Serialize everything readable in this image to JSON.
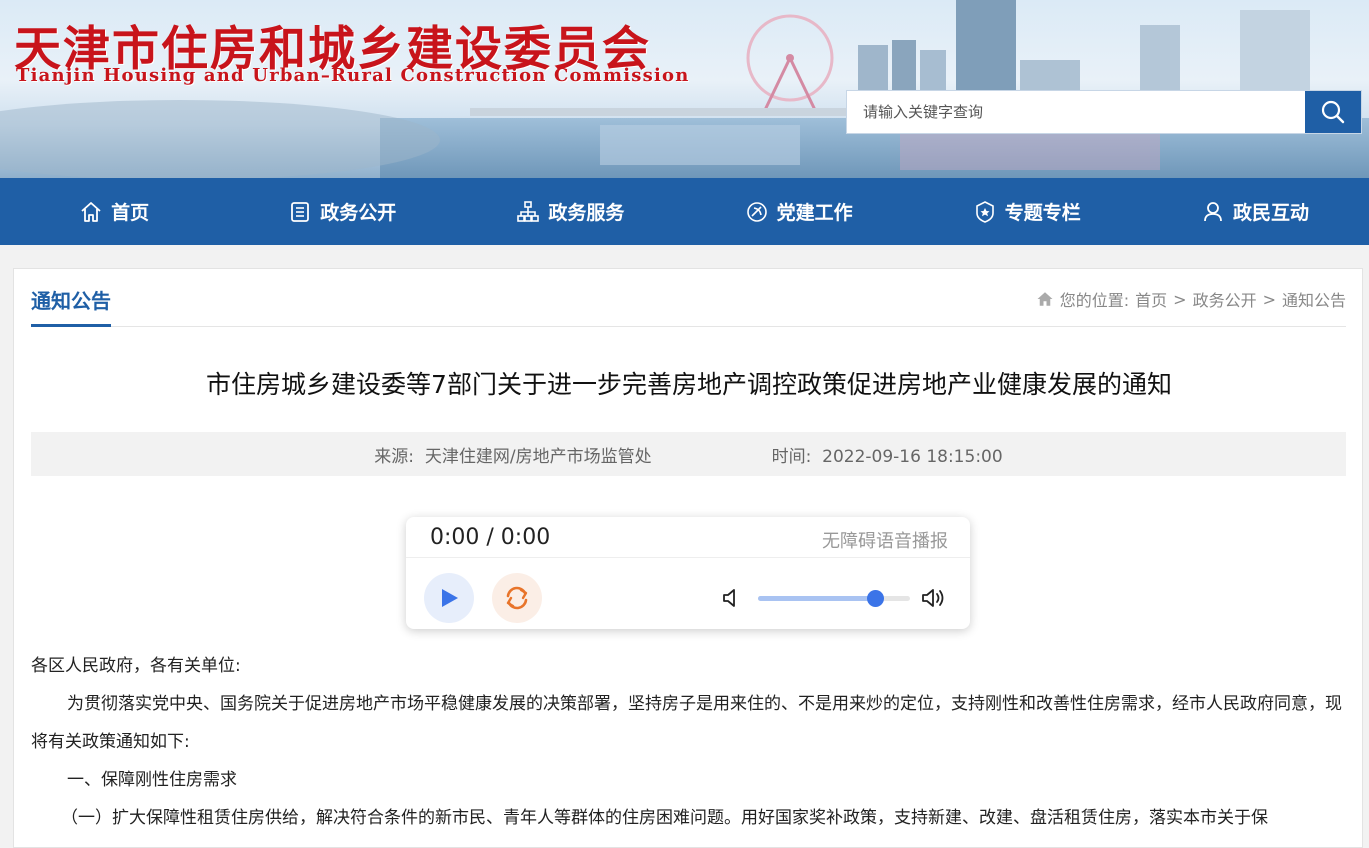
{
  "header": {
    "title": "天津市住房和城乡建设委员会",
    "subtitle": "Tianjin Housing and Urban–Rural Construction Commission",
    "search_placeholder": "请输入关键字查询"
  },
  "nav": [
    {
      "label": "首页",
      "icon": "home-icon"
    },
    {
      "label": "政务公开",
      "icon": "document-icon"
    },
    {
      "label": "政务服务",
      "icon": "org-chart-icon"
    },
    {
      "label": "党建工作",
      "icon": "party-emblem-icon"
    },
    {
      "label": "专题专栏",
      "icon": "badge-icon"
    },
    {
      "label": "政民互动",
      "icon": "user-icon"
    }
  ],
  "section": {
    "title": "通知公告",
    "breadcrumb_prefix": "您的位置:",
    "breadcrumb": [
      "首页",
      "政务公开",
      "通知公告"
    ],
    "separator": ">"
  },
  "article": {
    "title": "市住房城乡建设委等7部门关于进一步完善房地产调控政策促进房地产业健康发展的通知",
    "source_label": "来源:",
    "source": "天津住建网/房地产市场监管处",
    "time_label": "时间:",
    "time": "2022-09-16 18:15:00",
    "paragraphs": [
      "各区人民政府，各有关单位:",
      "为贯彻落实党中央、国务院关于促进房地产市场平稳健康发展的决策部署，坚持房子是用来住的、不是用来炒的定位，支持刚性和改善性住房需求，经市人民政府同意，现将有关政策通知如下:",
      "一、保障刚性住房需求",
      "（一）扩大保障性租赁住房供给，解决符合条件的新市民、青年人等群体的住房困难问题。用好国家奖补政策，支持新建、改建、盘活租赁住房，落实本市关于保"
    ]
  },
  "player": {
    "time_display": "0:00 / 0:00",
    "label": "无障碍语音播报",
    "volume": 0.77,
    "colors": {
      "accent": "#3b74e8",
      "loop": "#e8742a"
    }
  },
  "colors": {
    "brand": "#1f5fa6",
    "title_red": "#c8141b"
  }
}
